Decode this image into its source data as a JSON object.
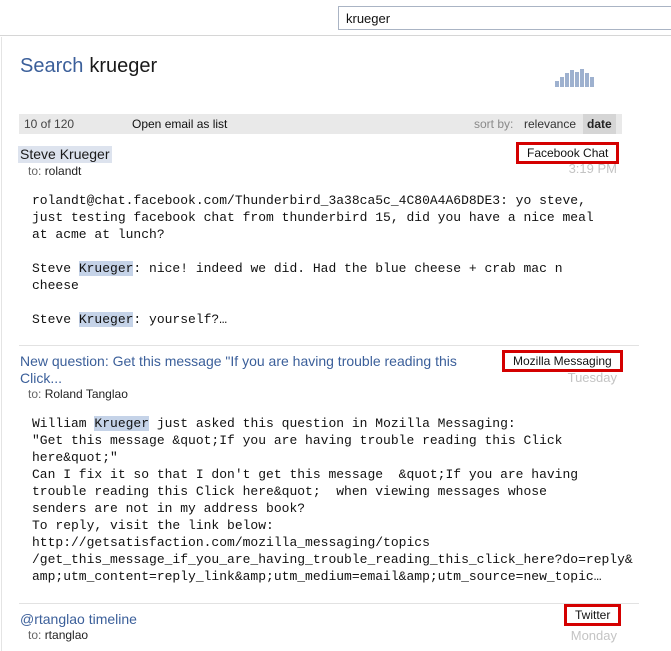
{
  "search": {
    "query": "krueger"
  },
  "page": {
    "title_label": "Search",
    "title_query": "krueger"
  },
  "toolbar": {
    "count": "10 of 120",
    "open_list": "Open email as list",
    "sort_by": "sort by:",
    "relevance": "relevance",
    "date": "date"
  },
  "results": [
    {
      "subject": "Steve Krueger",
      "to_label": "to:",
      "to_name": "rolandt",
      "when": "3:19 PM",
      "source": "Facebook Chat",
      "snippet": [
        [
          "rolandt@chat.facebook.com/Thunderbird_3a38ca5c_4C80A4A6D8DE3: yo steve,"
        ],
        [
          "just testing facebook chat from thunderbird 15, did you have a nice meal"
        ],
        [
          "at acme at lunch?"
        ],
        [
          ""
        ],
        [
          "Steve ",
          "Krueger",
          ": nice! indeed we did. Had the blue cheese + crab mac n"
        ],
        [
          "cheese"
        ],
        [
          ""
        ],
        [
          "Steve ",
          "Krueger",
          ": yourself?…"
        ]
      ]
    },
    {
      "subject": "New question: Get this message \"If you are having trouble reading this Click...",
      "to_label": "to:",
      "to_name": "Roland Tanglao",
      "when": "Tuesday",
      "source": "Mozilla Messaging",
      "snippet": [
        [
          "William ",
          "Krueger",
          " just asked this question in Mozilla Messaging:"
        ],
        [
          "\"Get this message &quot;If you are having trouble reading this Click"
        ],
        [
          "here&quot;\""
        ],
        [
          "Can I fix it so that I don't get this message  &quot;If you are having"
        ],
        [
          "trouble reading this Click here&quot;  when viewing messages whose"
        ],
        [
          "senders are not in my address book?"
        ],
        [
          "To reply, visit the link below:"
        ],
        [
          "http://getsatisfaction.com/mozilla_messaging/topics"
        ],
        [
          "/get_this_message_if_you_are_having_trouble_reading_this_click_here?do=reply&"
        ],
        [
          "amp;utm_content=reply_link&amp;utm_medium=email&amp;utm_source=new_topic…"
        ]
      ]
    },
    {
      "subject": "@rtanglao timeline",
      "to_label": "to:",
      "to_name": "rtanglao",
      "when": "Monday",
      "source": "Twitter"
    }
  ]
}
